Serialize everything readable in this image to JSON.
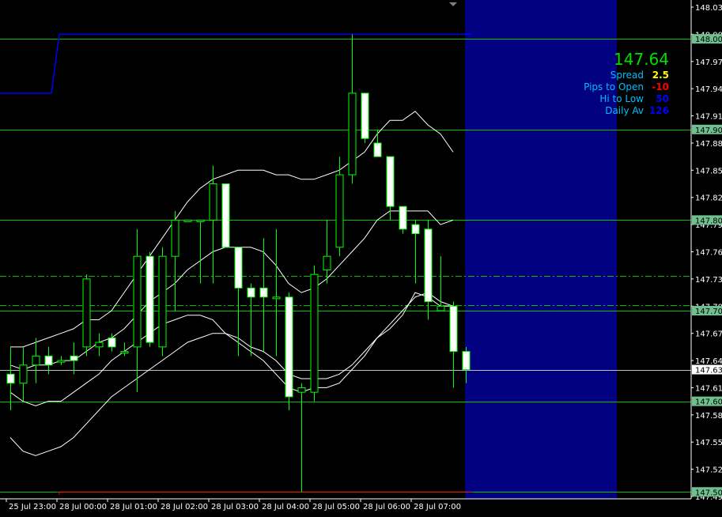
{
  "colors": {
    "background": "#000000",
    "grid_level": "#00c000",
    "candle_up": "#000000",
    "candle_down": "#ffffff",
    "wick": "#00ff00",
    "band": "#ffffff",
    "future_zone": "#000080",
    "high_line": "#0000ff",
    "low_line": "#ff0000",
    "price_label_bg": "#6fbf8f",
    "current_label_bg": "#ffffff",
    "axis_text": "#ffffff"
  },
  "chart_data": {
    "type": "candlestick",
    "symbol_timeframe": "M5",
    "y_axis": {
      "min": 147.495,
      "max": 148.035,
      "ticks": [
        "148.035",
        "148.005",
        "147.975",
        "147.945",
        "147.915",
        "147.885",
        "147.855",
        "147.825",
        "147.795",
        "147.765",
        "147.735",
        "147.705",
        "147.675",
        "147.645",
        "147.615",
        "147.585",
        "147.555",
        "147.525",
        "147.495"
      ]
    },
    "x_axis": {
      "labels": [
        "25 Jul 23:00",
        "28 Jul 00:00",
        "28 Jul 01:00",
        "28 Jul 02:00",
        "28 Jul 03:00",
        "28 Jul 04:00",
        "28 Jul 05:00",
        "28 Jul 06:00",
        "28 Jul 07:00"
      ]
    },
    "level_lines": [
      {
        "price": 148.0,
        "label": "148.000"
      },
      {
        "price": 147.9,
        "label": "147.900"
      },
      {
        "price": 147.8,
        "label": "147.800"
      },
      {
        "price": 147.7,
        "label": "147.700"
      },
      {
        "price": 147.6,
        "label": "147.600"
      },
      {
        "price": 147.5,
        "label": "147.500"
      }
    ],
    "current_price": {
      "price": 147.635,
      "label": "147.635"
    },
    "dashed_lines": [
      147.738,
      147.706
    ],
    "candles": [
      {
        "o": 147.63,
        "h": 147.66,
        "l": 147.59,
        "c": 147.62
      },
      {
        "o": 147.62,
        "h": 147.66,
        "l": 147.6,
        "c": 147.64
      },
      {
        "o": 147.64,
        "h": 147.67,
        "l": 147.62,
        "c": 147.65
      },
      {
        "o": 147.65,
        "h": 147.66,
        "l": 147.63,
        "c": 147.64
      },
      {
        "o": 147.645,
        "h": 147.65,
        "l": 147.64,
        "c": 147.645
      },
      {
        "o": 147.65,
        "h": 147.665,
        "l": 147.63,
        "c": 147.645
      },
      {
        "o": 147.66,
        "h": 147.74,
        "l": 147.65,
        "c": 147.735
      },
      {
        "o": 147.66,
        "h": 147.675,
        "l": 147.65,
        "c": 147.665
      },
      {
        "o": 147.67,
        "h": 147.675,
        "l": 147.655,
        "c": 147.66
      },
      {
        "o": 147.655,
        "h": 147.665,
        "l": 147.65,
        "c": 147.655
      },
      {
        "o": 147.66,
        "h": 147.79,
        "l": 147.61,
        "c": 147.76
      },
      {
        "o": 147.76,
        "h": 147.765,
        "l": 147.66,
        "c": 147.665
      },
      {
        "o": 147.66,
        "h": 147.77,
        "l": 147.65,
        "c": 147.76
      },
      {
        "o": 147.76,
        "h": 147.81,
        "l": 147.7,
        "c": 147.8
      },
      {
        "o": 147.8,
        "h": 147.8,
        "l": 147.8,
        "c": 147.8
      },
      {
        "o": 147.8,
        "h": 147.8,
        "l": 147.73,
        "c": 147.8
      },
      {
        "o": 147.8,
        "h": 147.86,
        "l": 147.73,
        "c": 147.84
      },
      {
        "o": 147.84,
        "h": 147.84,
        "l": 147.77,
        "c": 147.77
      },
      {
        "o": 147.77,
        "h": 147.77,
        "l": 147.65,
        "c": 147.725
      },
      {
        "o": 147.725,
        "h": 147.73,
        "l": 147.65,
        "c": 147.715
      },
      {
        "o": 147.725,
        "h": 147.78,
        "l": 147.655,
        "c": 147.715
      },
      {
        "o": 147.715,
        "h": 147.79,
        "l": 147.65,
        "c": 147.715
      },
      {
        "o": 147.715,
        "h": 147.72,
        "l": 147.59,
        "c": 147.605
      },
      {
        "o": 147.61,
        "h": 147.62,
        "l": 147.5,
        "c": 147.615
      },
      {
        "o": 147.61,
        "h": 147.75,
        "l": 147.6,
        "c": 147.74
      },
      {
        "o": 147.745,
        "h": 147.8,
        "l": 147.73,
        "c": 147.76
      },
      {
        "o": 147.77,
        "h": 147.87,
        "l": 147.76,
        "c": 147.85
      },
      {
        "o": 147.85,
        "h": 148.005,
        "l": 147.84,
        "c": 147.94
      },
      {
        "o": 147.94,
        "h": 147.94,
        "l": 147.885,
        "c": 147.89
      },
      {
        "o": 147.885,
        "h": 147.9,
        "l": 147.875,
        "c": 147.87
      },
      {
        "o": 147.87,
        "h": 147.87,
        "l": 147.8,
        "c": 147.815
      },
      {
        "o": 147.815,
        "h": 147.815,
        "l": 147.785,
        "c": 147.79
      },
      {
        "o": 147.795,
        "h": 147.8,
        "l": 147.73,
        "c": 147.785
      },
      {
        "o": 147.79,
        "h": 147.8,
        "l": 147.69,
        "c": 147.71
      },
      {
        "o": 147.7,
        "h": 147.76,
        "l": 147.7,
        "c": 147.705
      },
      {
        "o": 147.705,
        "h": 147.71,
        "l": 147.615,
        "c": 147.655
      },
      {
        "o": 147.655,
        "h": 147.66,
        "l": 147.62,
        "c": 147.635
      }
    ],
    "band_upper": [
      147.66,
      147.66,
      147.665,
      147.67,
      147.675,
      147.68,
      147.69,
      147.69,
      147.7,
      147.72,
      147.74,
      147.76,
      147.78,
      147.8,
      147.82,
      147.835,
      147.845,
      147.85,
      147.855,
      147.855,
      147.855,
      147.85,
      147.85,
      147.845,
      147.845,
      147.85,
      147.855,
      147.865,
      147.875,
      147.895,
      147.91,
      147.91,
      147.92,
      147.905,
      147.895,
      147.875
    ],
    "band_middle": [
      147.64,
      147.635,
      147.64,
      147.64,
      147.645,
      147.645,
      147.655,
      147.665,
      147.67,
      147.68,
      147.695,
      147.71,
      147.72,
      147.73,
      147.745,
      147.755,
      147.765,
      147.77,
      147.77,
      147.77,
      147.765,
      147.75,
      147.73,
      147.72,
      147.725,
      147.735,
      147.75,
      147.765,
      147.78,
      147.8,
      147.81,
      147.81,
      147.81,
      147.81,
      147.795,
      147.8
    ],
    "band_lower": [
      147.61,
      147.6,
      147.595,
      147.6,
      147.6,
      147.61,
      147.62,
      147.63,
      147.645,
      147.655,
      147.665,
      147.675,
      147.685,
      147.69,
      147.695,
      147.695,
      147.69,
      147.675,
      147.665,
      147.655,
      147.645,
      147.63,
      147.615,
      147.61,
      147.615,
      147.615,
      147.62,
      147.635,
      147.65,
      147.67,
      147.68,
      147.695,
      147.72,
      147.715,
      147.705,
      147.705
    ],
    "band_outer_lower": [
      147.56,
      147.545,
      147.54,
      147.545,
      147.55,
      147.56,
      147.575,
      147.59,
      147.605,
      147.615,
      147.625,
      147.635,
      147.645,
      147.655,
      147.665,
      147.67,
      147.675,
      147.675,
      147.67,
      147.66,
      147.655,
      147.645,
      147.63,
      147.625,
      147.625,
      147.625,
      147.63,
      147.64,
      147.655,
      147.67,
      147.685,
      147.7,
      147.715,
      147.72,
      147.71,
      147.705
    ],
    "daily_high": [
      {
        "from": 0,
        "to": 4,
        "price": 147.94
      },
      {
        "from": 4,
        "to": 36.5,
        "price": 148.005
      }
    ],
    "daily_low": [
      {
        "from": 4,
        "to": 36.5,
        "price": 147.5
      }
    ]
  },
  "info_panel": {
    "price": "147.64",
    "rows": [
      {
        "label": "Spread",
        "value": "2.5",
        "color": "#ffff00"
      },
      {
        "label": "Pips to Open",
        "value": "-10",
        "color": "#ff0000"
      },
      {
        "label": "Hi to Low",
        "value": "50",
        "color": "#0000ff"
      },
      {
        "label": "Daily Av",
        "value": "126",
        "color": "#0000ff"
      }
    ]
  }
}
